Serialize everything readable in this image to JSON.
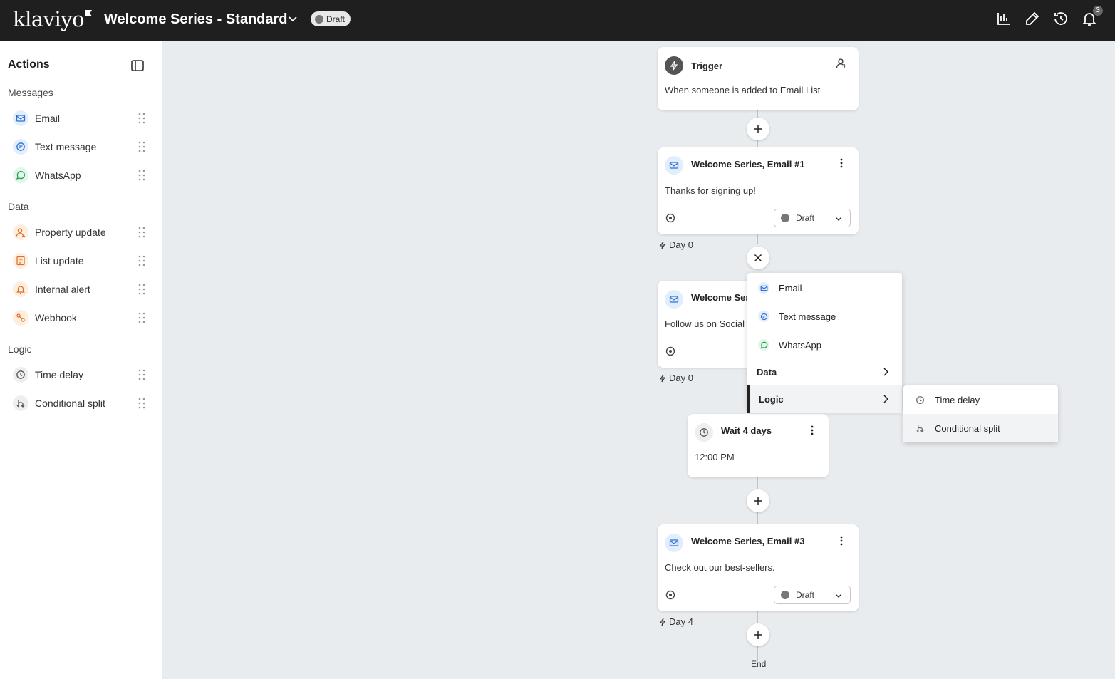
{
  "header": {
    "logo_text": "klaviyo",
    "flow_title": "Welcome Series - Standard",
    "status_pill": "Draft",
    "notification_count": "3",
    "icons": [
      "analytics-icon",
      "pencil-icon",
      "history-icon",
      "bell-icon"
    ]
  },
  "sidebar": {
    "title": "Actions",
    "sections": {
      "messages": "Messages",
      "data": "Data",
      "logic": "Logic"
    },
    "items": [
      {
        "label": "Email",
        "icon": "mail-icon",
        "color": "#2f6fd6",
        "bg": "#e3eefc"
      },
      {
        "label": "Text message",
        "icon": "chat-icon",
        "color": "#2f6fd6",
        "bg": "#e3eefc"
      },
      {
        "label": "WhatsApp",
        "icon": "whatsapp-icon",
        "color": "#25a35a",
        "bg": "#e3f6ea"
      },
      {
        "label": "Property update",
        "icon": "user-edit-icon",
        "color": "#e0702a",
        "bg": "#fdeede"
      },
      {
        "label": "List update",
        "icon": "list-icon",
        "color": "#e0702a",
        "bg": "#fdeede"
      },
      {
        "label": "Internal alert",
        "icon": "bell-icon",
        "color": "#e0702a",
        "bg": "#fdeede"
      },
      {
        "label": "Webhook",
        "icon": "webhook-icon",
        "color": "#e0702a",
        "bg": "#fdeede"
      },
      {
        "label": "Time delay",
        "icon": "clock-icon",
        "color": "#555555",
        "bg": "#eeeeee"
      },
      {
        "label": "Conditional split",
        "icon": "split-icon",
        "color": "#555555",
        "bg": "#eeeeee"
      }
    ]
  },
  "flow": {
    "trigger": {
      "title": "Trigger",
      "description": "When someone is added to Email List"
    },
    "email1": {
      "title": "Welcome Series, Email #1",
      "body": "Thanks for signing up!",
      "status": "Draft",
      "day": "Day 0"
    },
    "email2": {
      "title": "Welcome Ser",
      "body": "Follow us on Social",
      "day": "Day 0"
    },
    "wait": {
      "title": "Wait 4 days",
      "time": "12:00 PM"
    },
    "email3": {
      "title": "Welcome Series, Email #3",
      "body": "Check out our best-sellers.",
      "status": "Draft",
      "day": "Day 4"
    },
    "end_label": "End"
  },
  "add_menu": {
    "items": [
      {
        "label": "Email",
        "icon": "mail-icon"
      },
      {
        "label": "Text message",
        "icon": "chat-icon"
      },
      {
        "label": "WhatsApp",
        "icon": "whatsapp-icon"
      }
    ],
    "data_label": "Data",
    "logic_label": "Logic"
  },
  "logic_submenu": {
    "items": [
      {
        "label": "Time delay",
        "icon": "clock-icon"
      },
      {
        "label": "Conditional split",
        "icon": "split-icon"
      }
    ]
  }
}
